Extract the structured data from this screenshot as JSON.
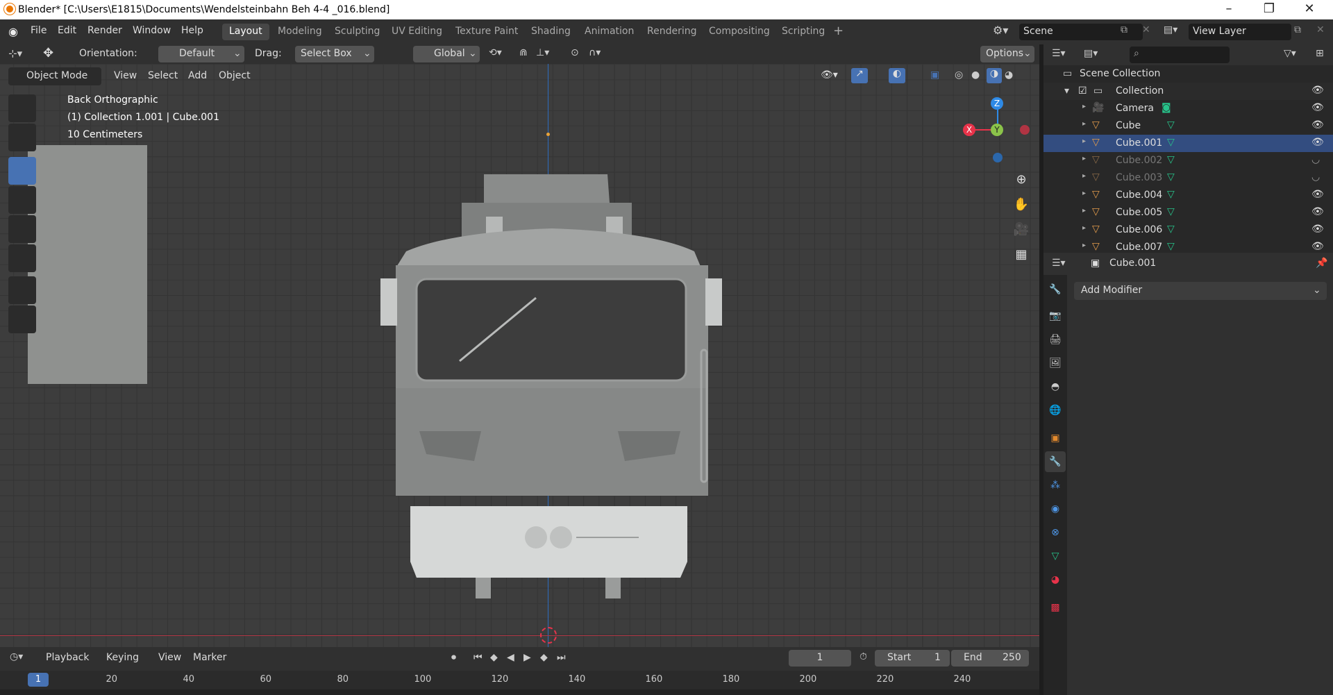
{
  "titlebar": {
    "title": "Blender* [C:\\Users\\E1815\\Documents\\Wendelsteinbahn Beh 4-4 _016.blend]"
  },
  "menu": [
    "File",
    "Edit",
    "Render",
    "Window",
    "Help"
  ],
  "workspaces": [
    "Layout",
    "Modeling",
    "Sculpting",
    "UV Editing",
    "Texture Paint",
    "Shading",
    "Animation",
    "Rendering",
    "Compositing",
    "Scripting"
  ],
  "scene": {
    "label": "Scene"
  },
  "viewlayer": {
    "label": "View Layer"
  },
  "toolheader": {
    "orientation_label": "Orientation:",
    "orientation_value": "Default",
    "drag_label": "Drag:",
    "drag_value": "Select Box",
    "transform": "Global",
    "options": "Options"
  },
  "viewheader": {
    "mode": "Object Mode",
    "menus": [
      "View",
      "Select",
      "Add",
      "Object"
    ]
  },
  "viewport": {
    "view_name": "Back Orthographic",
    "collection_info": "(1) Collection 1.001 | Cube.001",
    "scale": "10 Centimeters",
    "gizmo": {
      "x": "X",
      "y": "Y",
      "z": "Z"
    }
  },
  "outliner": {
    "scene_collection": "Scene Collection",
    "collection": "Collection",
    "items": [
      {
        "name": "Camera",
        "dim": false
      },
      {
        "name": "Cube",
        "dim": false
      },
      {
        "name": "Cube.001",
        "dim": false
      },
      {
        "name": "Cube.002",
        "dim": true
      },
      {
        "name": "Cube.003",
        "dim": true
      },
      {
        "name": "Cube.004",
        "dim": false
      },
      {
        "name": "Cube.005",
        "dim": false
      },
      {
        "name": "Cube.006",
        "dim": false
      },
      {
        "name": "Cube.007",
        "dim": false
      }
    ]
  },
  "properties": {
    "object_name": "Cube.001",
    "add_modifier": "Add Modifier"
  },
  "timeline": {
    "menus": [
      "Playback",
      "Keying",
      "View",
      "Marker"
    ],
    "current_frame": "1",
    "start_label": "Start",
    "start": "1",
    "end_label": "End",
    "end": "250",
    "ruler": [
      "1",
      "20",
      "40",
      "60",
      "80",
      "100",
      "120",
      "140",
      "160",
      "180",
      "200",
      "220",
      "240"
    ]
  },
  "colors": {
    "accent": "#4772b3",
    "x_axis": "#e8334a",
    "y_axis": "#8bc34a",
    "z_axis": "#2e8ae6",
    "mesh_icon": "#e39c4c"
  }
}
